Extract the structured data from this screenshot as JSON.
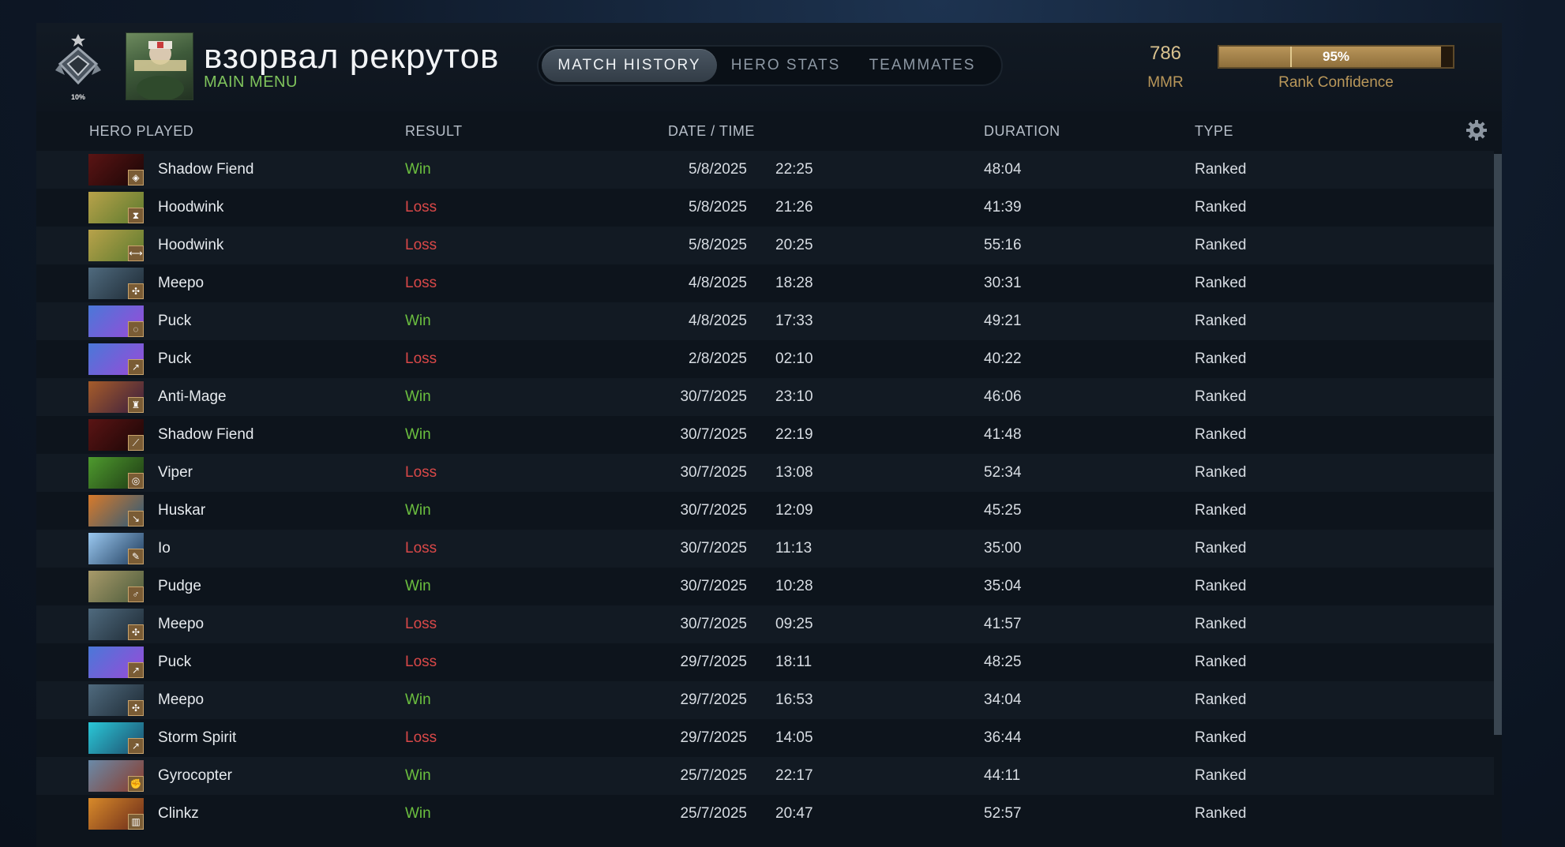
{
  "header": {
    "rank_percent": "10%",
    "player_name": "взорвал рекрутов",
    "main_menu": "MAIN MENU",
    "tabs": [
      {
        "label": "MATCH HISTORY",
        "active": true
      },
      {
        "label": "HERO STATS",
        "active": false
      },
      {
        "label": "TEAMMATES",
        "active": false
      }
    ],
    "mmr_value": "786",
    "mmr_label": "MMR",
    "rank_confidence": {
      "value": 0.95,
      "text": "95%",
      "label": "Rank Confidence"
    }
  },
  "columns": {
    "hero": "HERO PLAYED",
    "result": "RESULT",
    "datetime": "DATE / TIME",
    "duration": "DURATION",
    "type": "TYPE"
  },
  "colors": {
    "win": "#6bbf3f",
    "loss": "#d94848",
    "accent_gold": "#b9975a",
    "menu_green": "#7fc35c"
  },
  "matches": [
    {
      "hero": "Shadow Fiend",
      "result": "Win",
      "date": "5/8/2025",
      "time": "22:25",
      "duration": "48:04",
      "type": "Ranked",
      "badge_icon": "defense-icon"
    },
    {
      "hero": "Hoodwink",
      "result": "Loss",
      "date": "5/8/2025",
      "time": "21:26",
      "duration": "41:39",
      "type": "Ranked",
      "badge_icon": "hourglass-icon"
    },
    {
      "hero": "Hoodwink",
      "result": "Loss",
      "date": "5/8/2025",
      "time": "20:25",
      "duration": "55:16",
      "type": "Ranked",
      "badge_icon": "dumbbell-icon"
    },
    {
      "hero": "Meepo",
      "result": "Loss",
      "date": "4/8/2025",
      "time": "18:28",
      "duration": "30:31",
      "type": "Ranked",
      "badge_icon": "cluster-icon"
    },
    {
      "hero": "Puck",
      "result": "Win",
      "date": "4/8/2025",
      "time": "17:33",
      "duration": "49:21",
      "type": "Ranked",
      "badge_icon": "swirl-icon"
    },
    {
      "hero": "Puck",
      "result": "Loss",
      "date": "2/8/2025",
      "time": "02:10",
      "duration": "40:22",
      "type": "Ranked",
      "badge_icon": "runner-icon"
    },
    {
      "hero": "Anti-Mage",
      "result": "Win",
      "date": "30/7/2025",
      "time": "23:10",
      "duration": "46:06",
      "type": "Ranked",
      "badge_icon": "tower-icon"
    },
    {
      "hero": "Shadow Fiend",
      "result": "Win",
      "date": "30/7/2025",
      "time": "22:19",
      "duration": "41:48",
      "type": "Ranked",
      "badge_icon": "slash-icon"
    },
    {
      "hero": "Viper",
      "result": "Loss",
      "date": "30/7/2025",
      "time": "13:08",
      "duration": "52:34",
      "type": "Ranked",
      "badge_icon": "target-icon"
    },
    {
      "hero": "Huskar",
      "result": "Win",
      "date": "30/7/2025",
      "time": "12:09",
      "duration": "45:25",
      "type": "Ranked",
      "badge_icon": "spear-icon"
    },
    {
      "hero": "Io",
      "result": "Loss",
      "date": "30/7/2025",
      "time": "11:13",
      "duration": "35:00",
      "type": "Ranked",
      "badge_icon": "wand-icon"
    },
    {
      "hero": "Pudge",
      "result": "Win",
      "date": "30/7/2025",
      "time": "10:28",
      "duration": "35:04",
      "type": "Ranked",
      "badge_icon": "mace-icon"
    },
    {
      "hero": "Meepo",
      "result": "Loss",
      "date": "30/7/2025",
      "time": "09:25",
      "duration": "41:57",
      "type": "Ranked",
      "badge_icon": "cluster-icon"
    },
    {
      "hero": "Puck",
      "result": "Loss",
      "date": "29/7/2025",
      "time": "18:11",
      "duration": "48:25",
      "type": "Ranked",
      "badge_icon": "runner-icon"
    },
    {
      "hero": "Meepo",
      "result": "Win",
      "date": "29/7/2025",
      "time": "16:53",
      "duration": "34:04",
      "type": "Ranked",
      "badge_icon": "cluster-icon"
    },
    {
      "hero": "Storm Spirit",
      "result": "Loss",
      "date": "29/7/2025",
      "time": "14:05",
      "duration": "36:44",
      "type": "Ranked",
      "badge_icon": "runner-icon"
    },
    {
      "hero": "Gyrocopter",
      "result": "Win",
      "date": "25/7/2025",
      "time": "22:17",
      "duration": "44:11",
      "type": "Ranked",
      "badge_icon": "fist-icon"
    },
    {
      "hero": "Clinkz",
      "result": "Win",
      "date": "25/7/2025",
      "time": "20:47",
      "duration": "52:57",
      "type": "Ranked",
      "badge_icon": "chart-icon"
    }
  ]
}
